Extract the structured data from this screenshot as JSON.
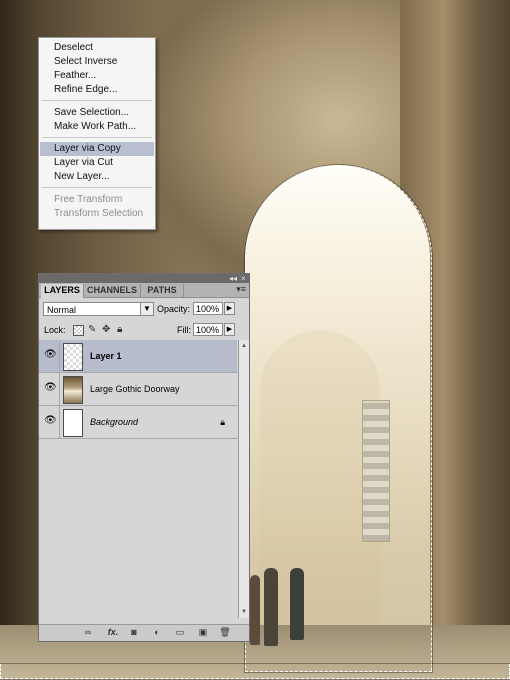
{
  "context_menu": {
    "items": [
      {
        "label": "Deselect"
      },
      {
        "label": "Select Inverse"
      },
      {
        "label": "Feather..."
      },
      {
        "label": "Refine Edge..."
      },
      {
        "label": "Save Selection..."
      },
      {
        "label": "Make Work Path..."
      },
      {
        "label": "Layer via Copy"
      },
      {
        "label": "Layer via Cut"
      },
      {
        "label": "New Layer..."
      },
      {
        "label": "Free Transform"
      },
      {
        "label": "Transform Selection"
      }
    ]
  },
  "layers_panel": {
    "tabs": [
      "LAYERS",
      "CHANNELS",
      "PATHS"
    ],
    "active_tab": "LAYERS",
    "collapse_glyph": "◂◂",
    "close_glyph": "×",
    "menu_glyph": "▾≡",
    "blend_mode": "Normal",
    "opacity_label": "Opacity:",
    "opacity_value": "100%",
    "lock_label": "Lock:",
    "fill_label": "Fill:",
    "fill_value": "100%",
    "layers": [
      {
        "name": "Layer 1",
        "selected": true
      },
      {
        "name": "Large Gothic Doorway",
        "selected": false
      },
      {
        "name": "Background",
        "selected": false,
        "locked": true
      }
    ],
    "bottom_icons": [
      "link-icon",
      "fx-icon",
      "mask-icon",
      "adjustment-icon",
      "group-icon",
      "new-layer-icon",
      "trash-icon"
    ],
    "fx_label": "fx."
  },
  "colors": {
    "menu_highlight": "#b9bfd3",
    "layer_selected": "#b7bccc",
    "panel_bg": "#d6d6d6",
    "titlebar": "#6a6a6a"
  }
}
